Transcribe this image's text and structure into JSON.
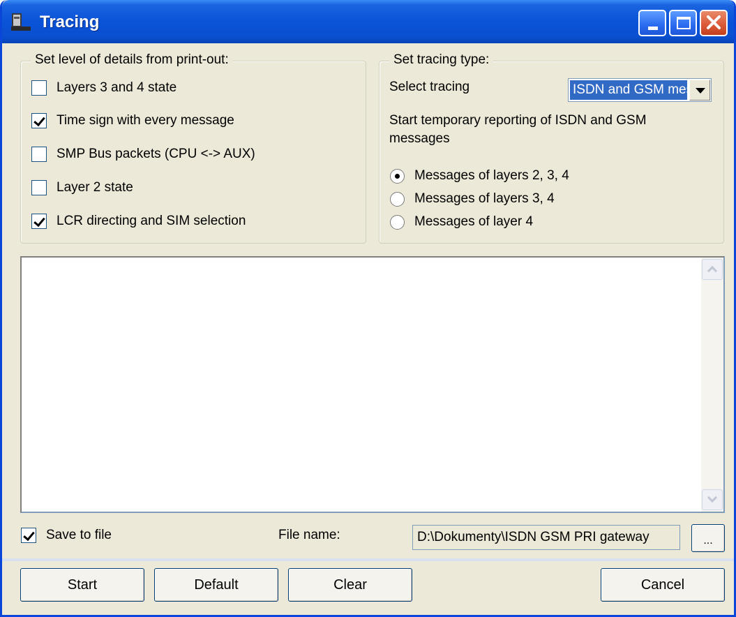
{
  "window": {
    "title": "Tracing"
  },
  "details_group": {
    "legend": "Set level of details from print-out:",
    "options": [
      {
        "label": "Layers 3 and 4 state",
        "checked": false
      },
      {
        "label": "Time sign with every message",
        "checked": true
      },
      {
        "label": "SMP Bus packets (CPU <-> AUX)",
        "checked": false
      },
      {
        "label": "Layer 2 state",
        "checked": false
      },
      {
        "label": "LCR directing and SIM selection",
        "checked": true
      }
    ]
  },
  "tracing_group": {
    "legend": "Set tracing type:",
    "select_label": "Select tracing",
    "select_value": "ISDN and GSM messages",
    "description": "Start temporary reporting of ISDN and GSM messages",
    "radios": [
      {
        "label": "Messages of layers 2, 3, 4",
        "selected": true
      },
      {
        "label": "Messages of layers 3, 4",
        "selected": false
      },
      {
        "label": "Messages of layer 4",
        "selected": false
      }
    ]
  },
  "output": {
    "text": ""
  },
  "save": {
    "label": "Save to file",
    "checked": true
  },
  "file": {
    "label": "File name:",
    "value": "D:\\Dokumenty\\ISDN GSM PRI gateway",
    "browse_label": "..."
  },
  "buttons": {
    "start": "Start",
    "default": "Default",
    "clear": "Clear",
    "cancel": "Cancel"
  }
}
